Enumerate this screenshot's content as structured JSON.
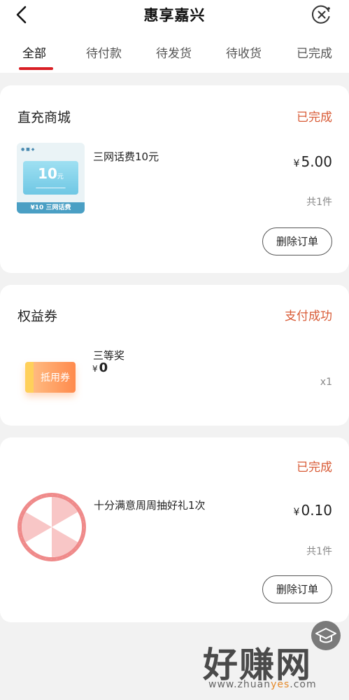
{
  "header": {
    "title": "惠享嘉兴",
    "back_icon": "chevron-left-icon",
    "close_icon": "close-circle-icon"
  },
  "tabs": [
    {
      "label": "全部",
      "active": true
    },
    {
      "label": "待付款",
      "active": false
    },
    {
      "label": "待发货",
      "active": false
    },
    {
      "label": "待收货",
      "active": false
    },
    {
      "label": "已完成",
      "active": false
    }
  ],
  "orders": [
    {
      "shop": "直充商城",
      "status": "已完成",
      "item": "三网话费10元",
      "currency": "¥",
      "price": "5.00",
      "qty": "共1件",
      "action": "删除订单",
      "thumb": {
        "value": "10",
        "unit": "元",
        "band": "¥10 三网话费"
      }
    },
    {
      "shop": "权益券",
      "status": "支付成功",
      "item": "三等奖",
      "currency": "¥",
      "price": "0",
      "qty": "x1",
      "thumb": {
        "label": "抵用券"
      }
    },
    {
      "shop": "",
      "status": "已完成",
      "item": "十分满意周周抽好礼1次",
      "currency": "¥",
      "price": "0.10",
      "qty": "共1件",
      "action": "删除订单"
    }
  ],
  "watermark": {
    "main": "好赚网",
    "url_pre": "www.zhuan",
    "url_hl": "yes",
    "url_post": ".com"
  },
  "colors": {
    "accent": "#d91f25",
    "status": "#d85a35"
  }
}
